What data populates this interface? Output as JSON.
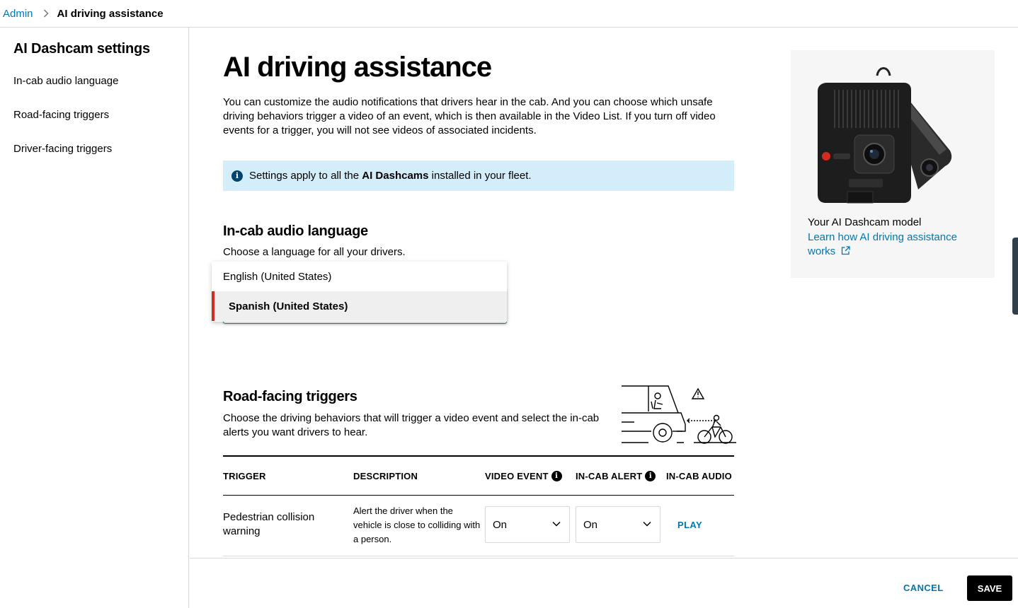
{
  "breadcrumb": {
    "parent": "Admin",
    "current": "AI driving assistance"
  },
  "sidebar": {
    "title": "AI Dashcam settings",
    "items": [
      {
        "label": "In-cab audio language"
      },
      {
        "label": "Road-facing triggers"
      },
      {
        "label": "Driver-facing triggers"
      }
    ]
  },
  "main": {
    "title": "AI driving assistance",
    "intro": "You can customize the audio notifications that drivers hear in the cab. And you can choose which unsafe driving behaviors trigger a video of an event, which is then available in the Video List. If you turn off video events for a trigger, you will not see videos of associated incidents.",
    "banner": {
      "prefix": "Settings apply to all the ",
      "bold": "AI Dashcams",
      "suffix": " installed in your fleet."
    },
    "language": {
      "title": "In-cab audio language",
      "description": "Choose a language for all your drivers.",
      "options": [
        "English (United States)",
        "Spanish (United States)"
      ],
      "selected": "Spanish (United States)"
    },
    "road": {
      "title": "Road-facing triggers",
      "description": "Choose the driving behaviors that will trigger a video event and select the in-cab alerts you want drivers to hear."
    },
    "table": {
      "headers": [
        "TRIGGER",
        "DESCRIPTION",
        "VIDEO EVENT",
        "IN-CAB ALERT",
        "IN-CAB AUDIO"
      ],
      "rows": [
        {
          "trigger": "Pedestrian collision warning",
          "description": "Alert the driver when the vehicle is close to colliding with a person.",
          "video_event": "On",
          "in_cab_alert": "On",
          "audio_action": "PLAY"
        }
      ]
    }
  },
  "device": {
    "model": "Your AI Dashcam model",
    "link": "Learn how AI driving assistance works"
  },
  "footer": {
    "cancel": "CANCEL",
    "save": "SAVE"
  },
  "colors": {
    "link": "#0077b4",
    "banner": "#d4edfb",
    "accent": "#d52b1e",
    "focus": "#0088ce"
  }
}
